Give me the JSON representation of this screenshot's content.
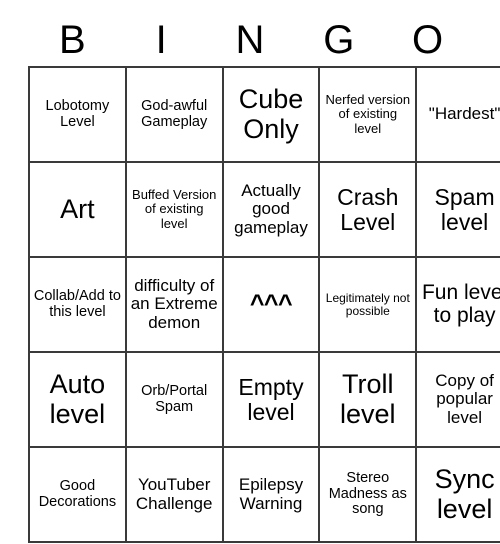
{
  "card": {
    "header_letters": [
      "B",
      "I",
      "N",
      "G",
      "O"
    ],
    "rows": [
      [
        {
          "text": "Lobotomy Level",
          "size": "sm"
        },
        {
          "text": "God-awful Gameplay",
          "size": "sm"
        },
        {
          "text": "Cube Only",
          "size": "xxl"
        },
        {
          "text": "Nerfed version of existing level",
          "size": "xs"
        },
        {
          "text": "\"Hardest\"",
          "size": "md"
        }
      ],
      [
        {
          "text": "Art",
          "size": "xxl"
        },
        {
          "text": "Buffed Version of existing level",
          "size": "xs"
        },
        {
          "text": "Actually good gameplay",
          "size": "md"
        },
        {
          "text": "Crash Level",
          "size": "xl"
        },
        {
          "text": "Spam level",
          "size": "xl"
        }
      ],
      [
        {
          "text": "Collab/Add to this level",
          "size": "sm"
        },
        {
          "text": "difficulty of an Extreme demon",
          "size": "md"
        },
        {
          "text": "^^^",
          "size": "caret"
        },
        {
          "text": "Legitimately not possible",
          "size": "xxs"
        },
        {
          "text": "Fun level to play",
          "size": "lg"
        }
      ],
      [
        {
          "text": "Auto level",
          "size": "xxl"
        },
        {
          "text": "Orb/Portal Spam",
          "size": "sm"
        },
        {
          "text": "Empty level",
          "size": "xl"
        },
        {
          "text": "Troll level",
          "size": "xxl"
        },
        {
          "text": "Copy of popular level",
          "size": "md"
        }
      ],
      [
        {
          "text": "Good Decorations",
          "size": "sm"
        },
        {
          "text": "YouTuber Challenge",
          "size": "md"
        },
        {
          "text": "Epilepsy Warning",
          "size": "md"
        },
        {
          "text": "Stereo Madness as song",
          "size": "sm"
        },
        {
          "text": "Sync level",
          "size": "xxl"
        }
      ]
    ]
  },
  "colors": {
    "background": "#ffffff",
    "text": "#000000",
    "border": "#3a3a3a"
  }
}
